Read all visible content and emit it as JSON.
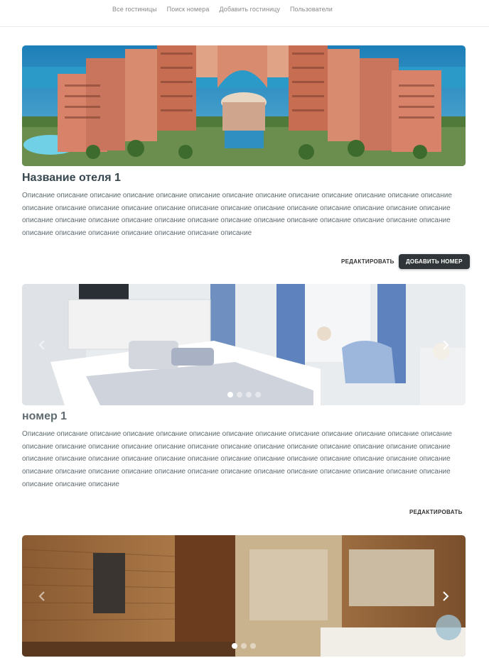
{
  "nav": {
    "items": [
      "Все гостиницы",
      "Поиск номера",
      "Добавить гостиницу",
      "Пользователи"
    ]
  },
  "hotel": {
    "title": "Название отеля 1",
    "description": "Описание описание описание описание описание описание описание описание описание описание описание описание описание описание описание описание описание описание описание описание описание описание описание описание описание описание описание описание описание описание описание описание описание описание описание описание описание описание описание описание описание описание описание описание описание описание",
    "edit_label": "РЕДАКТИРОВАТЬ",
    "add_room_label": "ДОБАВИТЬ НОМЕР"
  },
  "rooms": [
    {
      "title": "номер 1",
      "description": "Описание описание описание описание описание описание описание описание описание описание описание описание описание описание описание описание описание описание описание описание описание описание описание описание описание описание описание описание описание описание описание описание описание описание описание описание описание описание описание описание описание описание описание описание описание описание описание описание описание описание описание описание описание описание описание",
      "edit_label": "РЕДАКТИРОВАТЬ",
      "carousel_dots": 4,
      "active_dot": 0
    },
    {
      "carousel_dots": 3,
      "active_dot": 0
    }
  ],
  "icons": {
    "prev": "chevron-left-icon",
    "next": "chevron-right-icon"
  },
  "colors": {
    "primary_button": "#2f3538",
    "title_text": "#37474f",
    "body_text": "#5f6b70"
  }
}
